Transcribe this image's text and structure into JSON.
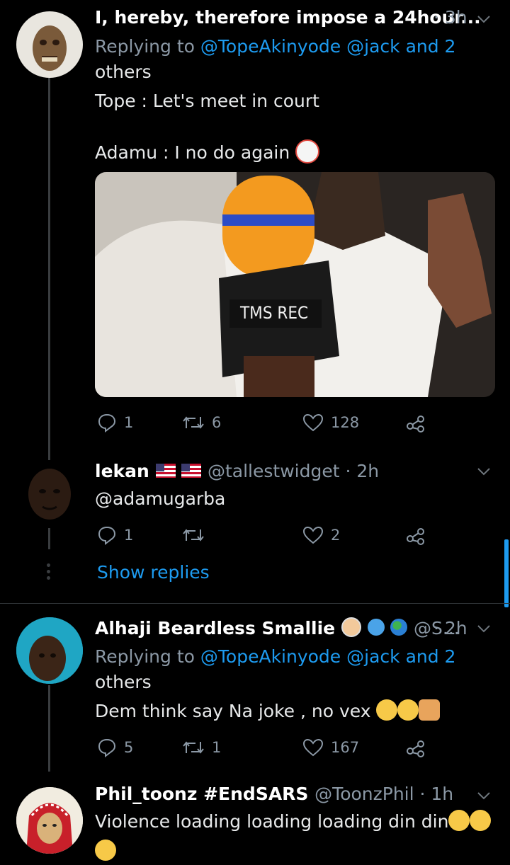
{
  "tweets": [
    {
      "display_name": "I, hereby, therefore impose a 24hour...",
      "time": "· 3h",
      "replying_prefix": "Replying to",
      "replying_mentions": "@TopeAkinyode @jack and 2",
      "replying_more": "others",
      "line1": "Tope : Let's meet in court",
      "line2": "Adamu : I no do again",
      "image_caption": "TMS REC",
      "reply_count": "1",
      "retweet_count": "6",
      "like_count": "128"
    },
    {
      "display_name": "lekan",
      "handle": "@tallestwidget · 2h",
      "text": "@adamugarba",
      "reply_count": "1",
      "like_count": "2",
      "show_replies": "Show replies"
    },
    {
      "display_name": "Alhaji Beardless Smallie",
      "handle": "@S...",
      "time": "· 2h",
      "replying_prefix": "Replying to",
      "replying_mentions": "@TopeAkinyode @jack and 2",
      "replying_more": "others",
      "text": "Dem think say Na joke , no vex",
      "reply_count": "5",
      "retweet_count": "1",
      "like_count": "167"
    },
    {
      "display_name": "Phil_toonz #EndSARS",
      "handle": "@ToonzPhil · 1h",
      "text": "Violence loading loading loading din din"
    }
  ],
  "colors": {
    "link": "#1d9bf0",
    "muted": "#8b98a5",
    "background": "#000000"
  }
}
